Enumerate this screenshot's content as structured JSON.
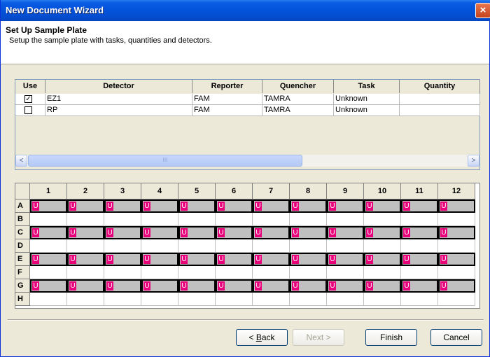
{
  "window": {
    "title": "New Document Wizard",
    "close_label": "×"
  },
  "header": {
    "title": "Set Up Sample Plate",
    "subtitle": "Setup the sample plate with tasks, quantities and detectors."
  },
  "detector_table": {
    "columns": [
      "Use",
      "Detector",
      "Reporter",
      "Quencher",
      "Task",
      "Quantity"
    ],
    "rows": [
      {
        "use": true,
        "check": "✓",
        "detector": "EZ1",
        "reporter": "FAM",
        "quencher": "TAMRA",
        "task": "Unknown",
        "quantity": ""
      },
      {
        "use": false,
        "check": "",
        "detector": "RP",
        "reporter": "FAM",
        "quencher": "TAMRA",
        "task": "Unknown",
        "quantity": ""
      }
    ]
  },
  "scrollbar": {
    "left_arrow": "<",
    "right_arrow": ">",
    "grip": "III"
  },
  "plate": {
    "columns": [
      "1",
      "2",
      "3",
      "4",
      "5",
      "6",
      "7",
      "8",
      "9",
      "10",
      "11",
      "12"
    ],
    "rows": [
      "A",
      "B",
      "C",
      "D",
      "E",
      "F",
      "G",
      "H"
    ],
    "filled_rows": [
      "A",
      "C",
      "E",
      "G"
    ],
    "well_badge": "U",
    "badge_color": "#e8007a"
  },
  "buttons": {
    "back_prefix": "< ",
    "back_key": "B",
    "back_rest": "ack",
    "next_label": "Next >",
    "finish_label": "Finish",
    "cancel_label": "Cancel"
  }
}
